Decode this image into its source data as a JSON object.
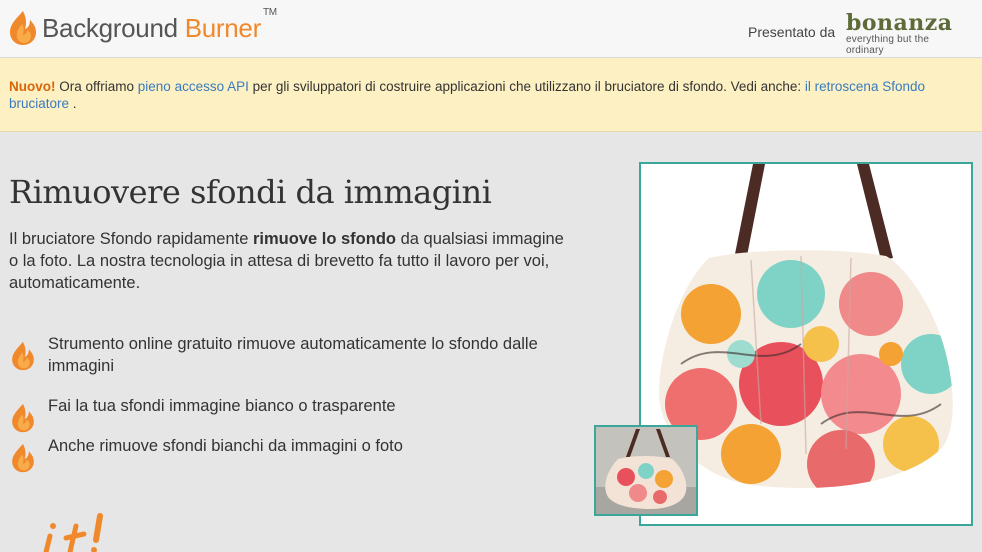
{
  "header": {
    "logo_part1": "Background",
    "logo_part2": "Burner",
    "logo_tm": "TM",
    "presented_by": "Presentato da",
    "sponsor_name": "bonanza",
    "sponsor_tagline": "everything but the ordinary"
  },
  "notice": {
    "new_label": "Nuovo!",
    "text1": " Ora offriamo ",
    "link1": "pieno accesso API",
    "text2": " per gli sviluppatori di costruire applicazioni che utilizzano il bruciatore di sfondo. Vedi anche: ",
    "link2": "il retroscena Sfondo bruciatore",
    "text3": " ."
  },
  "main": {
    "title": "Rimuovere sfondi da immagini",
    "intro_part1": "Il bruciatore Sfondo rapidamente ",
    "intro_bold": "rimuove lo sfondo",
    "intro_part2": " da qualsiasi immagine o la foto. La nostra tecnologia in attesa di brevetto fa tutto il lavoro per voi, automaticamente.",
    "features": [
      "Strumento online gratuito rimuove automaticamente lo sfondo dalle immagini",
      "Fai la tua sfondi immagine bianco o trasparente",
      "Anche rimuove sfondi bianchi da immagini o foto"
    ]
  },
  "colors": {
    "accent_orange": "#f0892b",
    "link_blue": "#3a7bbf",
    "frame_teal": "#3aa79a",
    "notice_bg": "#fdf0c3",
    "sponsor_green": "#5c6b38"
  },
  "icons": [
    "flame-icon",
    "feature-flame-icon"
  ]
}
